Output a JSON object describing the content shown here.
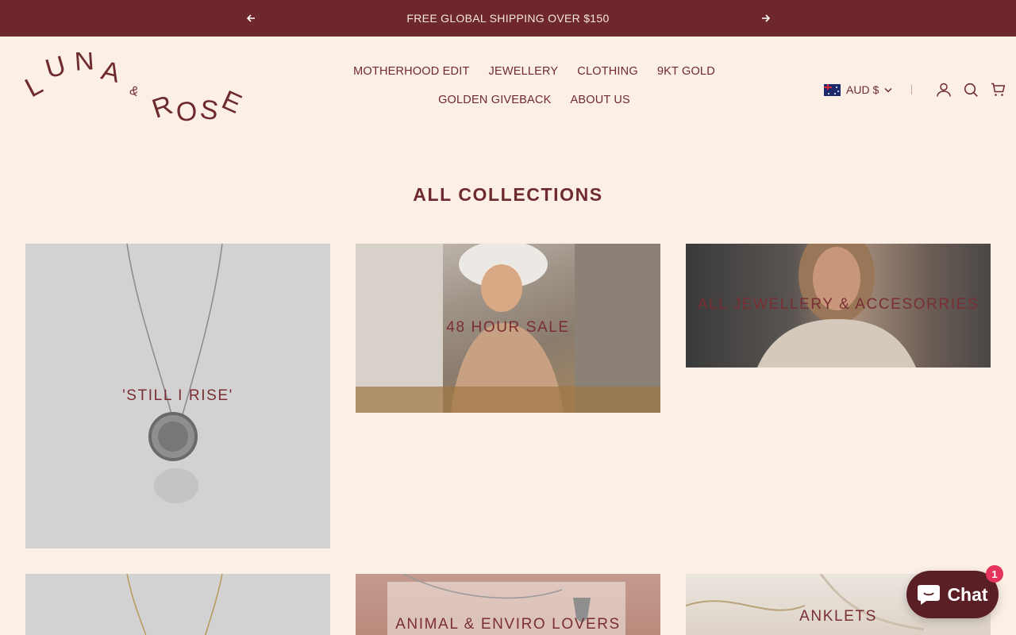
{
  "announcement": {
    "message": "FREE GLOBAL SHIPPING OVER $150",
    "prev_icon": "arrow-left-icon",
    "next_icon": "arrow-right-icon"
  },
  "logo": {
    "text": "LUNA & ROSE"
  },
  "nav": {
    "items": [
      {
        "label": "MOTHERHOOD EDIT"
      },
      {
        "label": "JEWELLERY"
      },
      {
        "label": "CLOTHING"
      },
      {
        "label": "9KT GOLD"
      },
      {
        "label": "GOLDEN GIVEBACK"
      },
      {
        "label": "ABOUT US"
      }
    ]
  },
  "header_right": {
    "currency": "AUD $",
    "account_icon": "account-icon",
    "search_icon": "search-icon",
    "cart_icon": "cart-icon"
  },
  "page": {
    "title": "ALL COLLECTIONS"
  },
  "collections": [
    {
      "title": "'STILL I RISE'"
    },
    {
      "title": "48 HOUR SALE"
    },
    {
      "title": "ALL JEWELLERY & ACCESORRIES"
    },
    {
      "title": ""
    },
    {
      "title": "ANIMAL & ENVIRO LOVERS"
    },
    {
      "title": "ANKLETS"
    }
  ],
  "chat": {
    "label": "Chat",
    "badge": "1"
  },
  "colors": {
    "announcement_bg": "#6e272c",
    "page_bg": "#fcefe6",
    "brand": "#6e2a2e",
    "chat_bg": "#5a1e25",
    "badge": "#e4345c"
  }
}
